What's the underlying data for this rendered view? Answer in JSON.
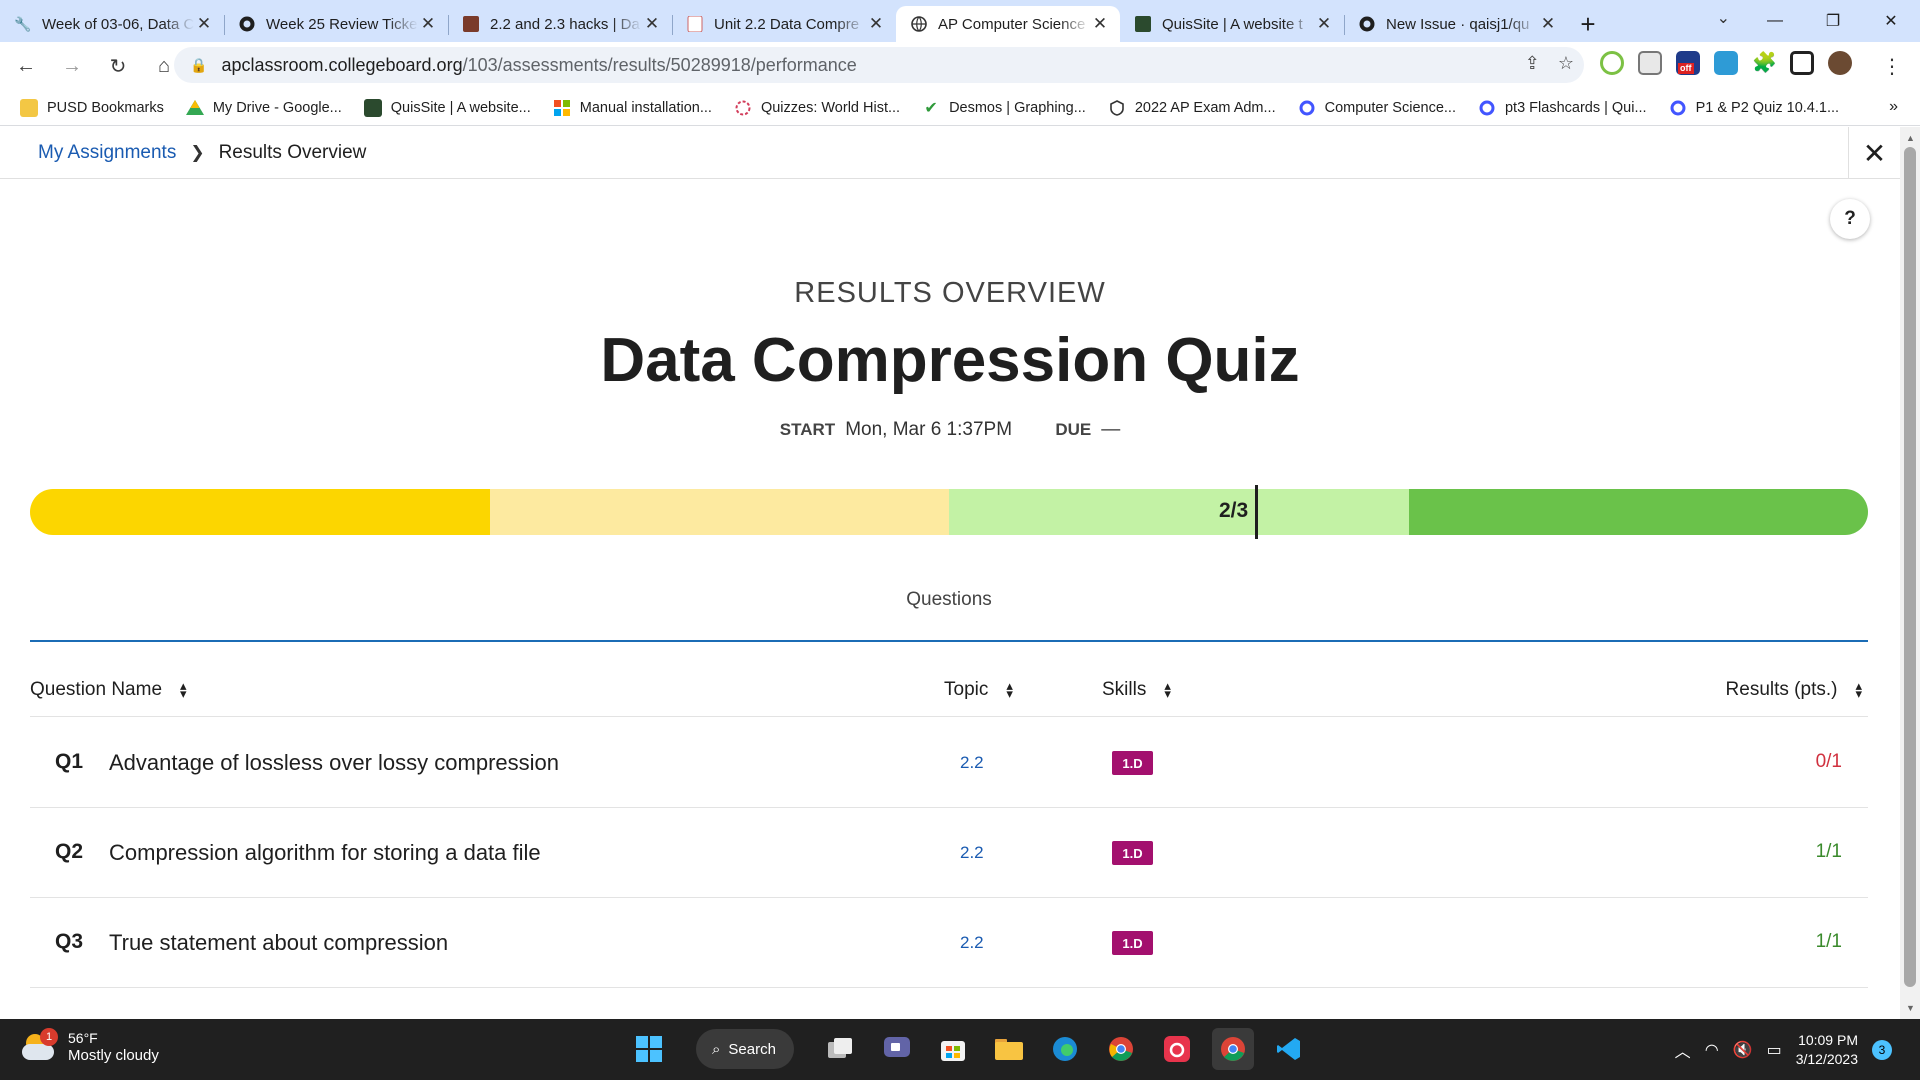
{
  "browser": {
    "tabs": [
      {
        "title": "Week of 03-06, Data C",
        "active": false
      },
      {
        "title": "Week 25 Review Ticke",
        "active": false
      },
      {
        "title": "2.2 and 2.3 hacks | Da",
        "active": false
      },
      {
        "title": "Unit 2.2 Data Compre",
        "active": false
      },
      {
        "title": "AP Computer Science",
        "active": true
      },
      {
        "title": "QuisSite | A website t",
        "active": false
      },
      {
        "title": "New Issue · qaisj1/qu",
        "active": false
      }
    ],
    "url_host": "apclassroom.collegeboard.org",
    "url_path": "/103/assessments/results/50289918/performance",
    "ext_off_badge": "off",
    "bookmarks": [
      "PUSD Bookmarks",
      "My Drive - Google...",
      "QuisSite | A website...",
      "Manual installation...",
      "Quizzes: World Hist...",
      "Desmos | Graphing...",
      "2022 AP Exam Adm...",
      "Computer Science...",
      "pt3 Flashcards | Qui...",
      "P1 & P2 Quiz 10.4.1..."
    ]
  },
  "page": {
    "breadcrumb": {
      "link": "My Assignments",
      "current": "Results Overview"
    },
    "help_label": "?",
    "overline": "RESULTS OVERVIEW",
    "title": "Data Compression Quiz",
    "start_label": "START",
    "start_value": "Mon, Mar 6 1:37PM",
    "due_label": "DUE",
    "due_value": "—",
    "score": {
      "label": "2/3",
      "value": 0.667
    },
    "progress_colors": [
      "#fcd600",
      "#fdeaa0",
      "#c3f2a5",
      "#6ac24a"
    ],
    "questions_tab": "Questions",
    "table": {
      "headers": {
        "name": "Question Name",
        "topic": "Topic",
        "skills": "Skills",
        "results": "Results (pts.)"
      },
      "rows": [
        {
          "num": "Q1",
          "name": "Advantage of lossless over lossy compression",
          "topic": "2.2",
          "skill": "1.D",
          "result": "0/1",
          "result_color": "#d0313f"
        },
        {
          "num": "Q2",
          "name": "Compression algorithm for storing a data file",
          "topic": "2.2",
          "skill": "1.D",
          "result": "1/1",
          "result_color": "#3a8a2b"
        },
        {
          "num": "Q3",
          "name": "True statement about compression",
          "topic": "2.2",
          "skill": "1.D",
          "result": "1/1",
          "result_color": "#3a8a2b"
        }
      ]
    }
  },
  "taskbar": {
    "weather_badge": "1",
    "temperature": "56°F",
    "condition": "Mostly cloudy",
    "search_label": "Search",
    "time": "10:09 PM",
    "date": "3/12/2023",
    "notification_count": "3"
  }
}
